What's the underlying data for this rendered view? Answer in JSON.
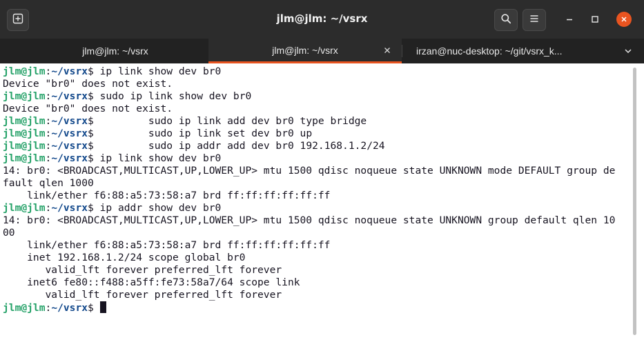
{
  "window": {
    "title": "jlm@jlm: ~/vsrx"
  },
  "header": {
    "new_tab_icon": "new-tab-icon",
    "search_icon": "search-icon",
    "menu_icon": "hamburger-menu-icon",
    "minimize_icon": "minimize-icon",
    "maximize_icon": "maximize-icon",
    "close_icon": "close-icon",
    "close_color": "#e95420"
  },
  "tabs": [
    {
      "label": "jlm@jlm: ~/vsrx",
      "active": false
    },
    {
      "label": "jlm@jlm: ~/vsrx",
      "active": true
    },
    {
      "label": "irzan@nuc-desktop: ~/git/vsrx_k...",
      "active": false
    }
  ],
  "terminal": {
    "colors": {
      "prompt_user": "#26a269",
      "prompt_path": "#12488b",
      "text": "#171421",
      "accent": "#e95420"
    },
    "prompt_user": "jlm@jlm",
    "prompt_sep": ":",
    "prompt_path": "~/vsrx",
    "prompt_end": "$",
    "lines": [
      {
        "prompt": true,
        "cmd": " ip link show dev br0"
      },
      {
        "prompt": false,
        "text": "Device \"br0\" does not exist."
      },
      {
        "prompt": true,
        "cmd": " sudo ip link show dev br0"
      },
      {
        "prompt": false,
        "text": "Device \"br0\" does not exist."
      },
      {
        "prompt": true,
        "cmd": "         sudo ip link add dev br0 type bridge"
      },
      {
        "prompt": true,
        "cmd": "         sudo ip link set dev br0 up"
      },
      {
        "prompt": true,
        "cmd": "         sudo ip addr add dev br0 192.168.1.2/24"
      },
      {
        "prompt": true,
        "cmd": " ip link show dev br0"
      },
      {
        "prompt": false,
        "text": "14: br0: <BROADCAST,MULTICAST,UP,LOWER_UP> mtu 1500 qdisc noqueue state UNKNOWN mode DEFAULT group de"
      },
      {
        "prompt": false,
        "text": "fault qlen 1000"
      },
      {
        "prompt": false,
        "text": "    link/ether f6:88:a5:73:58:a7 brd ff:ff:ff:ff:ff:ff"
      },
      {
        "prompt": true,
        "cmd": " ip addr show dev br0"
      },
      {
        "prompt": false,
        "text": "14: br0: <BROADCAST,MULTICAST,UP,LOWER_UP> mtu 1500 qdisc noqueue state UNKNOWN group default qlen 10"
      },
      {
        "prompt": false,
        "text": "00"
      },
      {
        "prompt": false,
        "text": "    link/ether f6:88:a5:73:58:a7 brd ff:ff:ff:ff:ff:ff"
      },
      {
        "prompt": false,
        "text": "    inet 192.168.1.2/24 scope global br0"
      },
      {
        "prompt": false,
        "text": "       valid_lft forever preferred_lft forever"
      },
      {
        "prompt": false,
        "text": "    inet6 fe80::f488:a5ff:fe73:58a7/64 scope link"
      },
      {
        "prompt": false,
        "text": "       valid_lft forever preferred_lft forever"
      },
      {
        "prompt": true,
        "cmd": " ",
        "cursor": true
      }
    ]
  }
}
